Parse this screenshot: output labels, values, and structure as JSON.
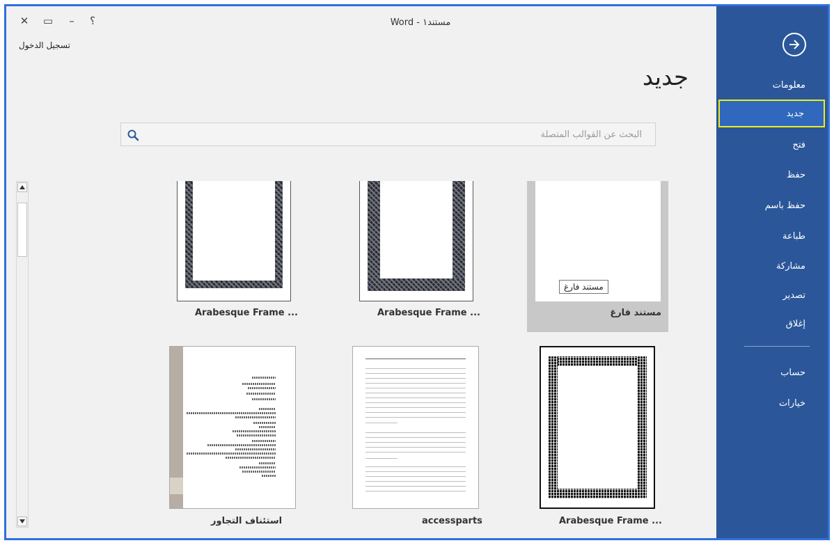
{
  "window": {
    "title": "Word - مستند١",
    "help_label": "؟",
    "minimize_label": "–",
    "restore_label": "▭",
    "close_label": "✕",
    "signin_label": "تسجيل الدخول"
  },
  "sidebar": {
    "items": [
      {
        "label": "معلومات",
        "active": false
      },
      {
        "label": "جديد",
        "active": true
      },
      {
        "label": "فتح",
        "active": false
      },
      {
        "label": "حفظ",
        "active": false
      },
      {
        "label": "حفظ باسم",
        "active": false
      },
      {
        "label": "طباعة",
        "active": false
      },
      {
        "label": "مشاركة",
        "active": false
      },
      {
        "label": "تصدير",
        "active": false
      },
      {
        "label": "إغلاق",
        "active": false
      }
    ],
    "bottom_items": [
      {
        "label": "حساب"
      },
      {
        "label": "خيارات"
      }
    ],
    "accent": "#2b579a",
    "highlight": "#f0ec1c"
  },
  "main": {
    "page_title": "جديد",
    "search_placeholder": "البحث عن القوالب المتصلة",
    "templates": [
      {
        "name": "مستند فارغ",
        "tooltip": "مستند فارغ",
        "selected": true
      },
      {
        "name": "Arabesque Frame ..."
      },
      {
        "name": "Arabesque Frame ..."
      },
      {
        "name": "Arabesque Frame ..."
      },
      {
        "name": "accessparts"
      },
      {
        "name": "استئناف التجاور"
      }
    ]
  }
}
